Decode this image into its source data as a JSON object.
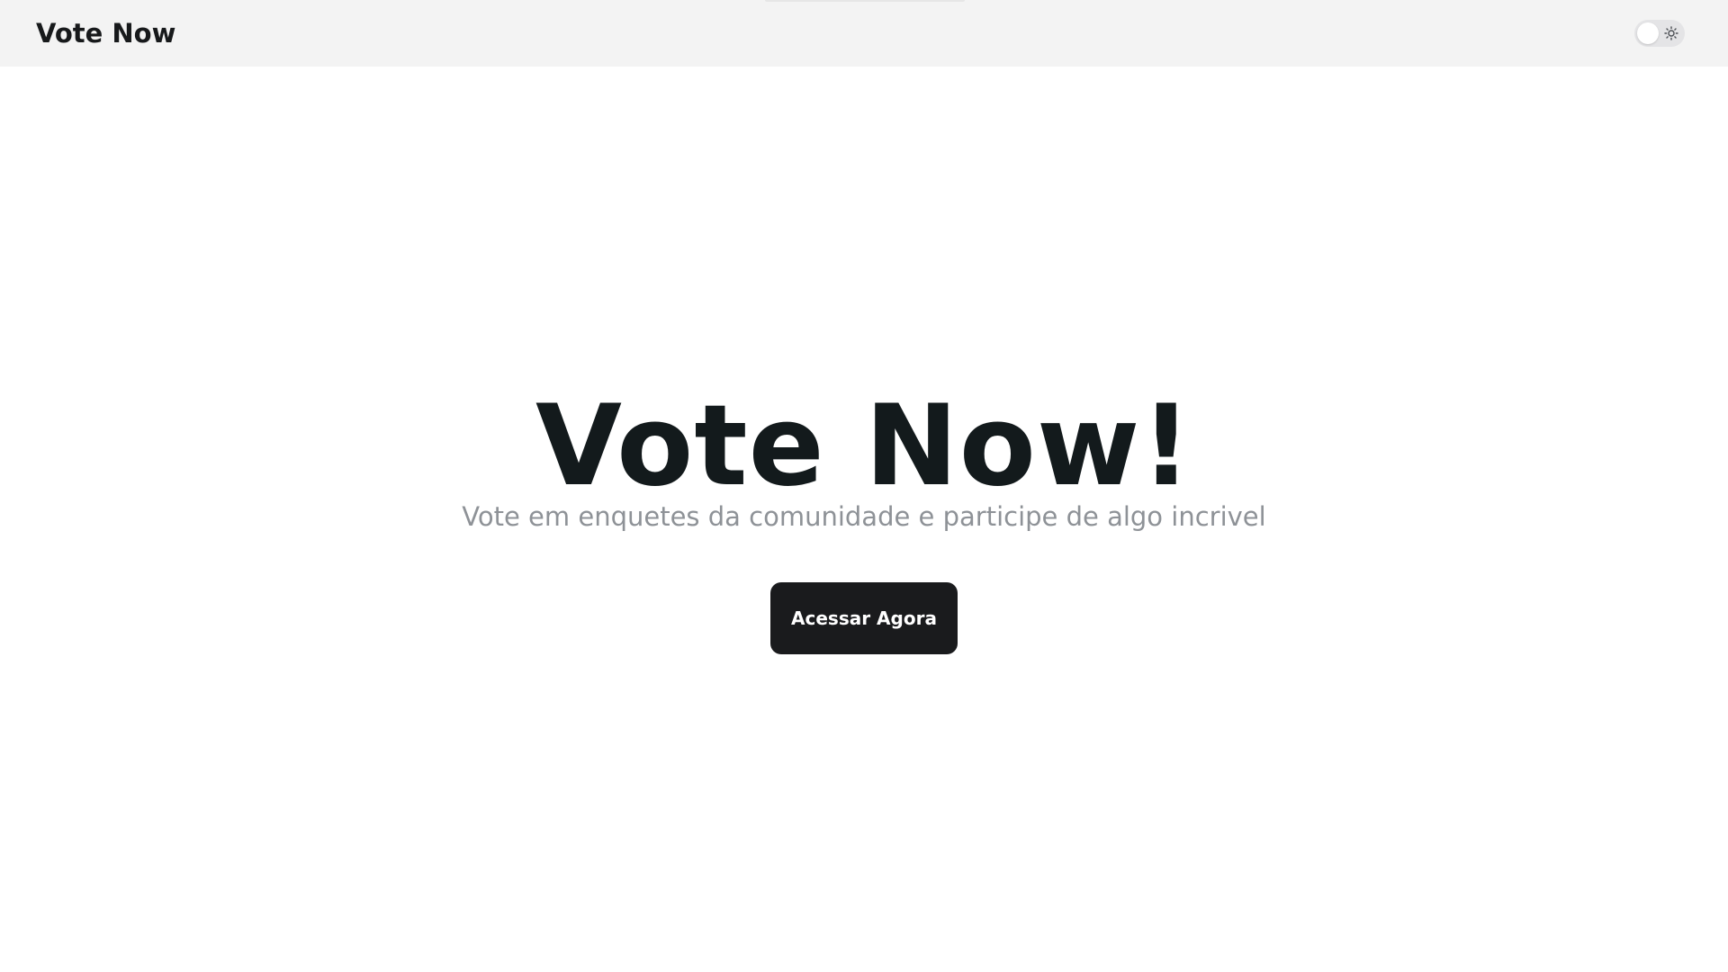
{
  "navbar": {
    "brand": "Vote Now",
    "theme_toggle": {
      "state": "light",
      "icon": "sun-icon"
    }
  },
  "hero": {
    "title": "Vote Now!",
    "subtitle": "Vote em enquetes da comunidade e participe de algo incrivel",
    "cta_label": "Acessar Agora"
  },
  "colors": {
    "navbar_background": "#f3f3f3",
    "title": "#131a1c",
    "subtitle": "#8e9297",
    "button_background": "#1a1b1d",
    "button_text": "#ffffff"
  }
}
